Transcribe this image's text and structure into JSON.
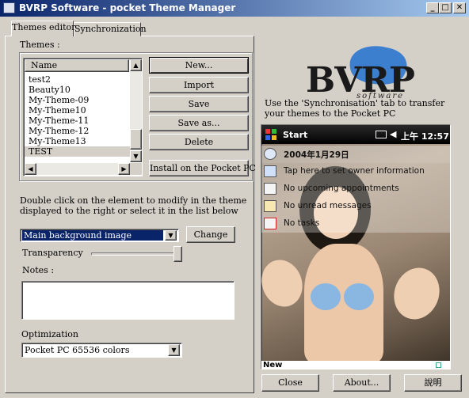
{
  "window": {
    "title": "BVRP Software - pocket Theme Manager",
    "minimize_glyph": "_",
    "maximize_glyph": "□",
    "close_glyph": "✕"
  },
  "tabs": [
    {
      "label": "Themes editor",
      "selected": true
    },
    {
      "label": "Synchronization",
      "selected": false
    }
  ],
  "themes": {
    "group_label": "Themes :",
    "column_header": "Name",
    "items": [
      "test2",
      "Beauty10",
      "My-Theme-09",
      "My-Theme10",
      "My-Theme-11",
      "My-Theme-12",
      "My-Theme13",
      "TEST"
    ],
    "selected": "TEST"
  },
  "actions": {
    "new": "New...",
    "import": "Import",
    "save": "Save",
    "save_as": "Save as...",
    "delete": "Delete",
    "install": "Install on the Pocket PC"
  },
  "element_hint": "Double click on the element to modify in the theme displayed to the right or select it in the list below",
  "element_select": {
    "value": "Main background image"
  },
  "change_button": "Change",
  "transparency": {
    "label": "Transparency",
    "value": 1.0
  },
  "notes": {
    "label": "Notes :",
    "value": ""
  },
  "optimization": {
    "label": "Optimization",
    "value": "Pocket PC 65536 colors"
  },
  "logo": {
    "brand": "BVRP",
    "tagline": "software"
  },
  "sync_hint": "Use the 'Synchronisation' tab to transfer your themes to the Pocket PC",
  "pocketpc": {
    "start": "Start",
    "status": "上午 12:57",
    "date": "2004年1月29日",
    "owner": "Tap here to set owner information",
    "appointments": "No upcoming appointments",
    "messages": "No unread messages",
    "tasks": "No tasks",
    "bottom_left": "New"
  },
  "footer": {
    "close": "Close",
    "about": "About...",
    "help": "說明"
  },
  "colors": {
    "face": "#d4d0c8",
    "title_start": "#0a246a",
    "title_end": "#a6caf0",
    "logo_blob": "#3d7fcf"
  }
}
